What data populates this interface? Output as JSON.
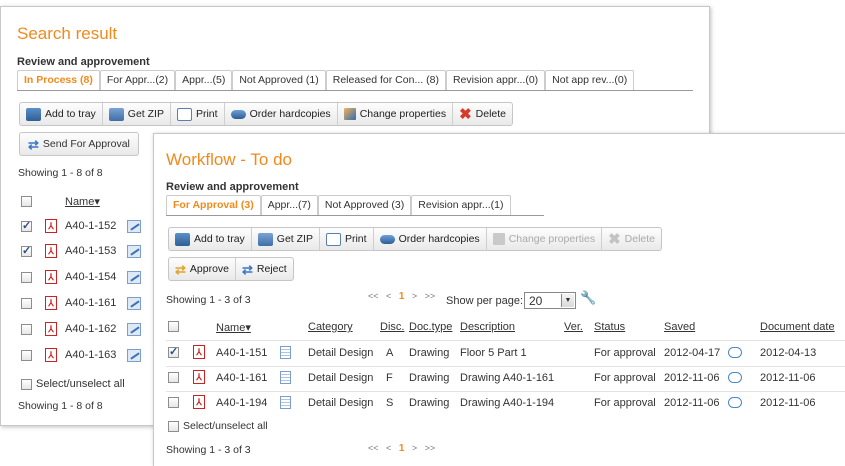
{
  "back_panel": {
    "title": "Search result",
    "subtitle": "Review and approvement",
    "tabs": [
      {
        "label": "In Process (8)",
        "active": true
      },
      {
        "label": "For Appr...(2)",
        "active": false
      },
      {
        "label": "Appr...(5)",
        "active": false
      },
      {
        "label": "Not Approved (1)",
        "active": false
      },
      {
        "label": "Released for Con... (8)",
        "active": false
      },
      {
        "label": "Revision appr...(0)",
        "active": false
      },
      {
        "label": "Not app rev...(0)",
        "active": false
      }
    ],
    "toolbar": {
      "add_to_tray": "Add to tray",
      "get_zip": "Get ZIP",
      "print": "Print",
      "order_hardcopies": "Order hardcopies",
      "change_properties": "Change properties",
      "delete": "Delete"
    },
    "send_for_approval": "Send For Approval",
    "showing_top": "Showing 1 - 8 of 8",
    "name_header": "Name",
    "rows": [
      {
        "name": "A40-1-152",
        "checked": true
      },
      {
        "name": "A40-1-153",
        "checked": true
      },
      {
        "name": "A40-1-154",
        "checked": false
      },
      {
        "name": "A40-1-161",
        "checked": false
      },
      {
        "name": "A40-1-162",
        "checked": false
      },
      {
        "name": "A40-1-163",
        "checked": false
      }
    ],
    "select_all": "Select/unselect all",
    "showing_bottom": "Showing 1 - 8 of 8"
  },
  "front_panel": {
    "title": "Workflow - To do",
    "subtitle": "Review and approvement",
    "tabs": [
      {
        "label": "For Approval (3)",
        "active": true
      },
      {
        "label": "Appr...(7)",
        "active": false
      },
      {
        "label": "Not Approved (3)",
        "active": false
      },
      {
        "label": "Revision appr...(1)",
        "active": false
      }
    ],
    "toolbar": {
      "add_to_tray": "Add to tray",
      "get_zip": "Get ZIP",
      "print": "Print",
      "order_hardcopies": "Order hardcopies",
      "change_properties": "Change properties",
      "delete": "Delete"
    },
    "approve": "Approve",
    "reject": "Reject",
    "showing_top": "Showing 1 - 3 of 3",
    "pager": {
      "first": "<<",
      "prev": "<",
      "current": "1",
      "next": ">",
      "last": ">>"
    },
    "show_per_page_label": "Show per page:",
    "per_page": "20",
    "columns": {
      "name": "Name",
      "category": "Category",
      "disc": "Disc.",
      "doc_type": "Doc.type",
      "description": "Description",
      "ver": "Ver.",
      "status": "Status",
      "saved": "Saved",
      "document_date": "Document date"
    },
    "rows": [
      {
        "name": "A40-1-151",
        "category": "Detail Design",
        "disc": "A",
        "doc_type": "Drawing",
        "description": "Floor 5 Part 1",
        "status": "For approval",
        "saved": "2012-04-17",
        "document_date": "2012-04-13",
        "checked": true
      },
      {
        "name": "A40-1-161",
        "category": "Detail Design",
        "disc": "F",
        "doc_type": "Drawing",
        "description": "Drawing A40-1-161",
        "status": "For approval",
        "saved": "2012-11-06",
        "document_date": "2012-11-06",
        "checked": false
      },
      {
        "name": "A40-1-194",
        "category": "Detail Design",
        "disc": "S",
        "doc_type": "Drawing",
        "description": "Drawing A40-1-194",
        "status": "For approval",
        "saved": "2012-11-06",
        "document_date": "2012-11-06",
        "checked": false
      }
    ],
    "select_all": "Select/unselect all",
    "showing_bottom": "Showing 1 - 3 of 3"
  }
}
